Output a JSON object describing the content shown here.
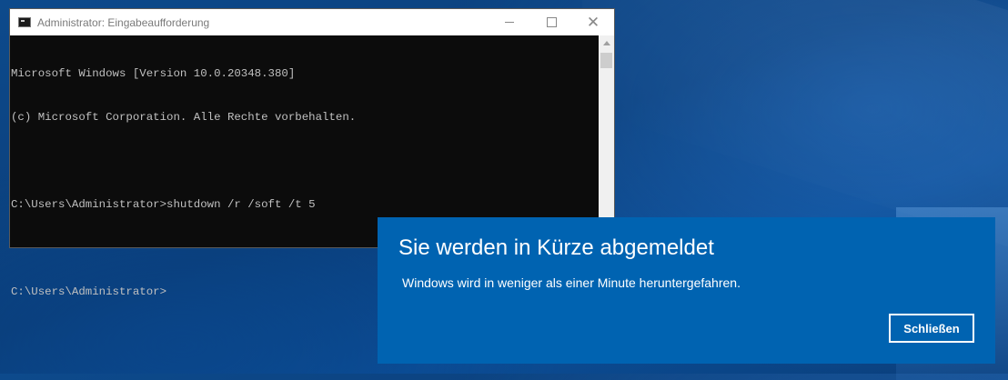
{
  "window": {
    "title": "Administrator: Eingabeaufforderung",
    "icon": "console-icon",
    "controls": {
      "minimize": "minimize-icon",
      "maximize": "maximize-icon",
      "close": "close-icon"
    }
  },
  "console": {
    "lines": [
      "Microsoft Windows [Version 10.0.20348.380]",
      "(c) Microsoft Corporation. Alle Rechte vorbehalten.",
      "",
      "C:\\Users\\Administrator>shutdown /r /soft /t 5",
      "",
      "C:\\Users\\Administrator>"
    ]
  },
  "notification": {
    "title": "Sie werden in Kürze abgemeldet",
    "message": "Windows wird in weniger als einer Minute heruntergefahren.",
    "button_label": "Schließen",
    "background_color": "#0063b1"
  }
}
